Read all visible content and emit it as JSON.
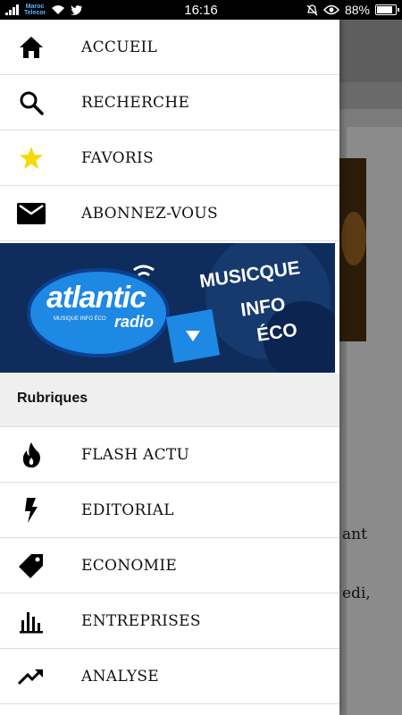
{
  "status_bar": {
    "time": "16:16",
    "battery": "88%",
    "carrier_badge": "Maroc Telecom"
  },
  "menu": {
    "top_items": [
      {
        "label": "ACCUEIL",
        "icon": "home-icon"
      },
      {
        "label": "RECHERCHE",
        "icon": "search-icon"
      },
      {
        "label": "FAVORIS",
        "icon": "star-icon"
      },
      {
        "label": "ABONNEZ-VOUS",
        "icon": "mail-icon"
      }
    ],
    "banner": {
      "brand": "atlantic",
      "brand_sub": "radio",
      "tagline_small": "MUSIQUE INFO ÉCO",
      "slogan_line1": "MUSICQUE",
      "slogan_line2": "INFO",
      "slogan_line3": "ÉCO"
    },
    "section_title": "Rubriques",
    "section_items": [
      {
        "label": "FLASH ACTU",
        "icon": "flame-icon"
      },
      {
        "label": "EDITORIAL",
        "icon": "bolt-icon"
      },
      {
        "label": "ECONOMIE",
        "icon": "tag-icon"
      },
      {
        "label": "ENTREPRISES",
        "icon": "bar-chart-icon"
      },
      {
        "label": "ANALYSE",
        "icon": "trending-up-icon"
      }
    ]
  },
  "background_content": {
    "text_fragment_1": "ant",
    "text_fragment_2": "edi,"
  },
  "colors": {
    "star": "#f5d90a",
    "banner_bg": "#0f2d5c",
    "banner_blue": "#1e88e5"
  }
}
